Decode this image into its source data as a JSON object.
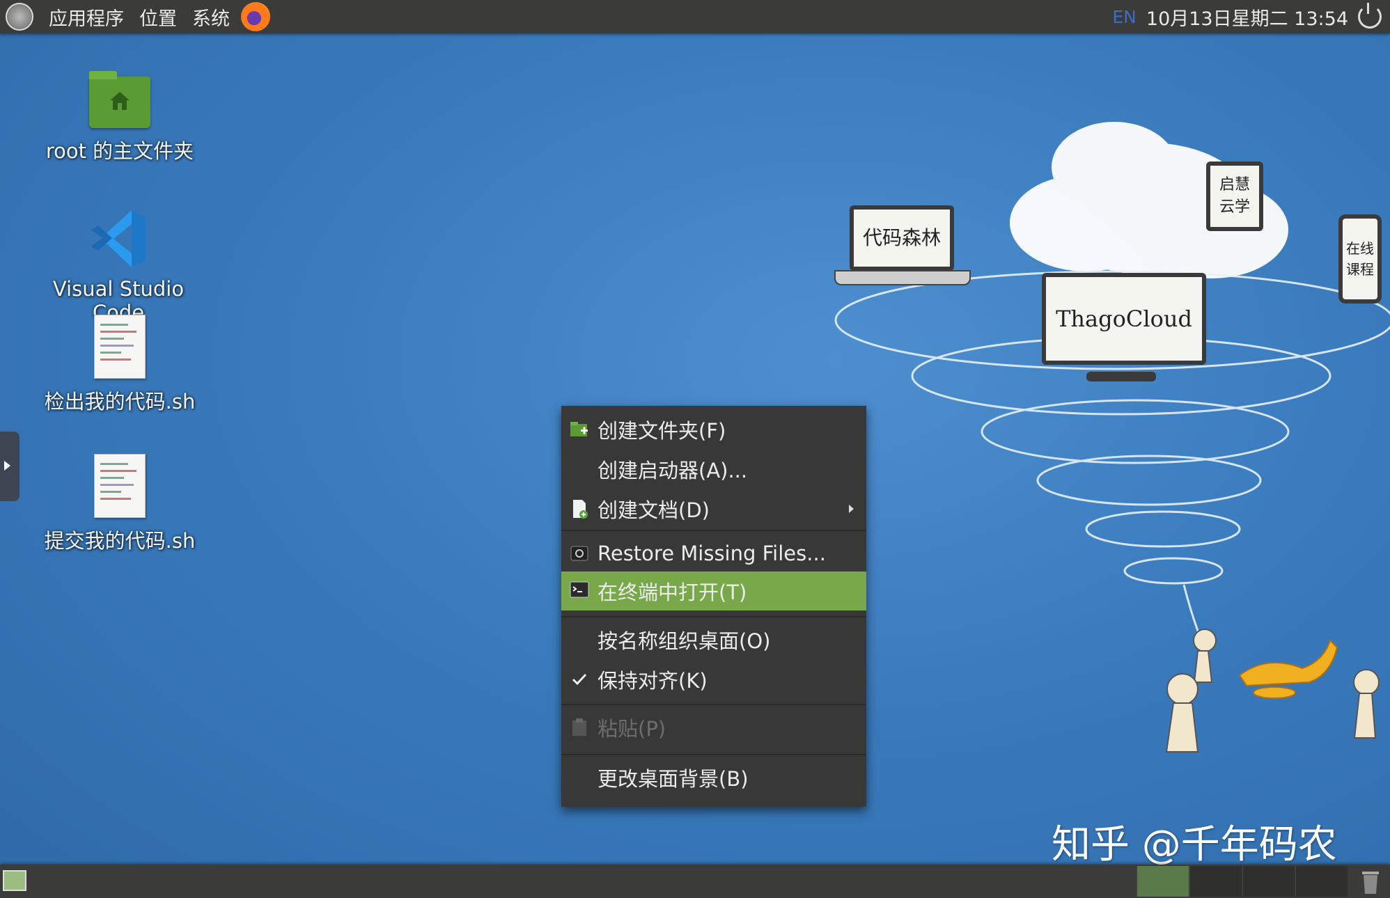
{
  "top_panel": {
    "menus": [
      "应用程序",
      "位置",
      "系统"
    ],
    "lang": "EN",
    "clock": "10月13日星期二 13:54"
  },
  "desktop_icons": [
    {
      "label": "root 的主文件夹",
      "icon": "home-folder-icon"
    },
    {
      "label": "Visual Studio Code",
      "icon": "vscode-icon"
    },
    {
      "label": "检出我的代码.sh",
      "icon": "script-file-icon"
    },
    {
      "label": "提交我的代码.sh",
      "icon": "script-file-icon"
    }
  ],
  "wallpaper": {
    "laptop_text": "代码森林",
    "monitor_text": "ThagoCloud",
    "tablet_text": "启慧\n云学",
    "phone_text": "在线\n课程"
  },
  "context_menu": {
    "items": [
      {
        "label": "创建文件夹(F)",
        "icon": "new-folder-icon"
      },
      {
        "label": "创建启动器(A)...",
        "icon": ""
      },
      {
        "label": "创建文档(D)",
        "icon": "new-document-icon",
        "submenu": true
      },
      {
        "label": "Restore Missing Files...",
        "icon": "restore-icon"
      },
      {
        "label": "在终端中打开(T)",
        "icon": "terminal-icon",
        "selected": true
      },
      {
        "label": "按名称组织桌面(O)",
        "icon": ""
      },
      {
        "label": "保持对齐(K)",
        "icon": "check-icon",
        "checked": true
      },
      {
        "label": "粘贴(P)",
        "icon": "paste-icon",
        "disabled": true
      },
      {
        "label": "更改桌面背景(B)",
        "icon": ""
      }
    ]
  },
  "watermark": "知乎 @千年码农",
  "colors": {
    "panel": "#3b3b3a",
    "menu_bg": "#383838",
    "menu_selected": "#78a84a",
    "desktop": "#3a7bbd"
  }
}
